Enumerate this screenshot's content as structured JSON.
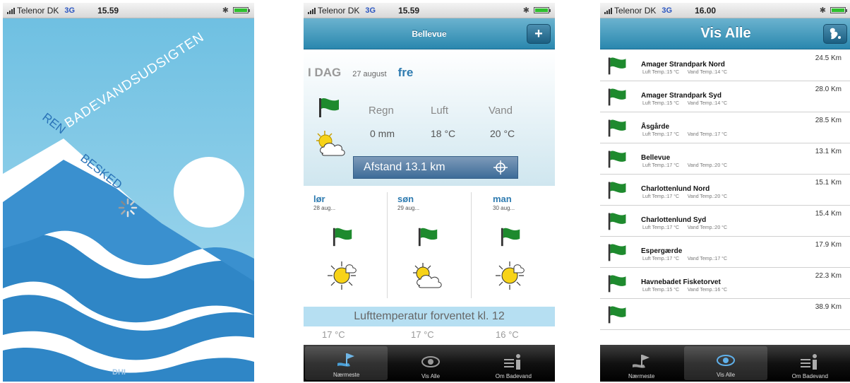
{
  "status": {
    "carrier": "Telenor DK",
    "network": "3G",
    "times": [
      "15.59",
      "15.59",
      "16.00"
    ]
  },
  "splash": {
    "title": "BADEVANDSUDSIGTEN",
    "tagline_a": "REN",
    "tagline_b": "BESKED",
    "brand": "DHI"
  },
  "detail": {
    "nav_title": "Bellevue",
    "add_button": "+",
    "today_label": "I DAG",
    "today_date": "27 august",
    "today_day": "fre",
    "col_labels": [
      "Regn",
      "Luft",
      "Vand"
    ],
    "col_values": [
      "0 mm",
      "18 °C",
      "20 °C"
    ],
    "distance": "Afstand 13.1 km",
    "forecast": [
      {
        "day": "lør",
        "date": "28 aug..."
      },
      {
        "day": "søn",
        "date": "29 aug..."
      },
      {
        "day": "man",
        "date": "30 aug..."
      }
    ],
    "temp_header": "Lufttemperatur forventet kl. 12",
    "temps": [
      "17 °C",
      "17 °C",
      "16 °C"
    ]
  },
  "list": {
    "nav_title": "Vis Alle",
    "items": [
      {
        "name": "Amager Strandpark Nord",
        "air": "Luft Temp.:15 °C",
        "water": "Vand Temp.:14 °C",
        "dist": "24.5 Km"
      },
      {
        "name": "Amager Strandpark Syd",
        "air": "Luft Temp.:15 °C",
        "water": "Vand Temp.:14 °C",
        "dist": "28.0 Km"
      },
      {
        "name": "Åsgårde",
        "air": "Luft Temp.:17 °C",
        "water": "Vand Temp.:17 °C",
        "dist": "28.5 Km"
      },
      {
        "name": "Bellevue",
        "air": "Luft Temp.:17 °C",
        "water": "Vand Temp.:20 °C",
        "dist": "13.1 Km"
      },
      {
        "name": "Charlottenlund Nord",
        "air": "Luft Temp.:17 °C",
        "water": "Vand Temp.:20 °C",
        "dist": "15.1 Km"
      },
      {
        "name": "Charlottenlund Syd",
        "air": "Luft Temp.:17 °C",
        "water": "Vand Temp.:20 °C",
        "dist": "15.4 Km"
      },
      {
        "name": "Espergærde",
        "air": "Luft Temp.:17 °C",
        "water": "Vand Temp.:17 °C",
        "dist": "17.9 Km"
      },
      {
        "name": "Havnebadet Fisketorvet",
        "air": "Luft Temp.:15 °C",
        "water": "Vand Temp.:16 °C",
        "dist": "22.3 Km"
      },
      {
        "name": "",
        "air": "",
        "water": "",
        "dist": "38.9 Km"
      }
    ]
  },
  "tabs": [
    "Nærmeste",
    "Vis Alle",
    "Om Badevand"
  ],
  "colors": {
    "accent": "#2a87ae",
    "flag": "#1e8a2e",
    "splash_blue": "#2a73b8"
  }
}
